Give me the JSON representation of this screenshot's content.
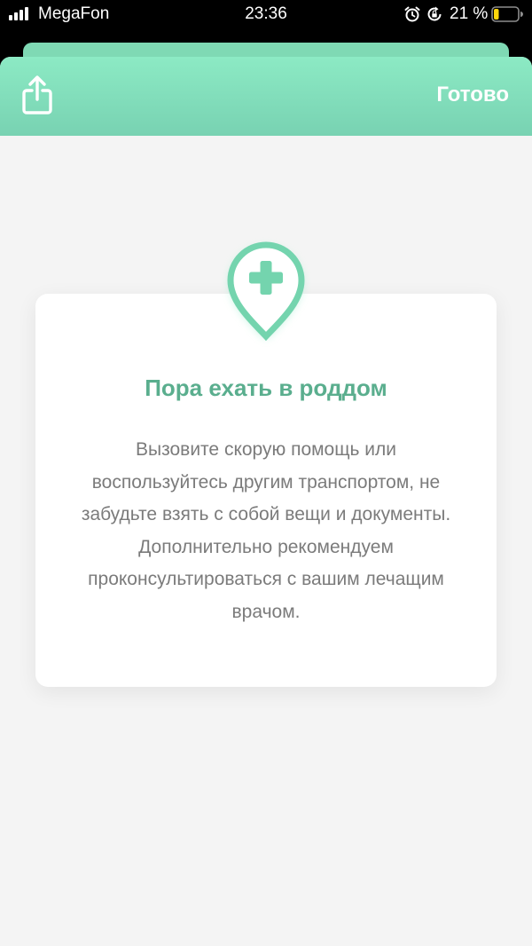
{
  "status_bar": {
    "carrier": "MegaFon",
    "time": "23:36",
    "battery_percent": "21 %",
    "battery_level": 0.21,
    "icons": [
      "signal-icon",
      "alarm-icon",
      "rotation-lock-icon",
      "battery-icon"
    ]
  },
  "header": {
    "share_icon": "share-icon",
    "done_label": "Готово"
  },
  "card": {
    "icon": "medical-location-pin-icon",
    "title": "Пора ехать в роддом",
    "text": "Вызовите скорую помощь или воспользуйтесь другим транспортом, не забудьте взять с собой вещи и документы. Дополнительно рекомендуем проконсультироваться с вашим лечащим врачом."
  },
  "colors": {
    "accent": "#7fd9b4",
    "title": "#5aae8e",
    "background": "#f4f4f4"
  }
}
